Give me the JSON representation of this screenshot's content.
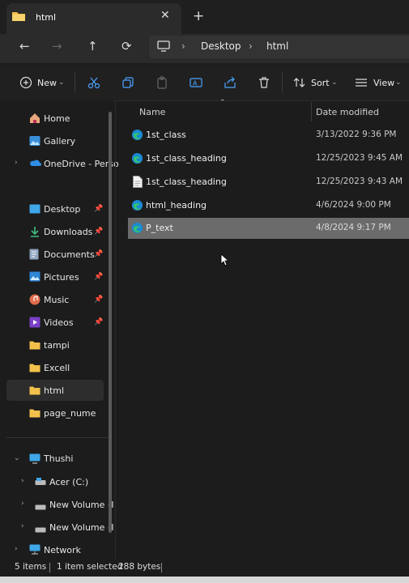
{
  "tab": {
    "title": "html",
    "close": "✕",
    "new": "+"
  },
  "nav": {
    "back": "←",
    "forward": "→",
    "up": "↑",
    "refresh": "⟳"
  },
  "breadcrumb": [
    "Desktop",
    "html"
  ],
  "toolbar": {
    "new_label": "New",
    "sort_label": "Sort",
    "view_label": "View"
  },
  "sidebar": {
    "items": [
      {
        "label": "Home"
      },
      {
        "label": "Gallery"
      },
      {
        "label": "OneDrive - Perso"
      },
      {
        "label": "Desktop"
      },
      {
        "label": "Downloads"
      },
      {
        "label": "Documents"
      },
      {
        "label": "Pictures"
      },
      {
        "label": "Music"
      },
      {
        "label": "Videos"
      },
      {
        "label": "tampi"
      },
      {
        "label": "Excell"
      },
      {
        "label": "html"
      },
      {
        "label": "page_nume"
      },
      {
        "label": "Thushi"
      },
      {
        "label": "Acer (C:)"
      },
      {
        "label": "New Volume (I"
      },
      {
        "label": "New Volume (I"
      },
      {
        "label": "Network"
      }
    ]
  },
  "columns": {
    "name": "Name",
    "date": "Date modified"
  },
  "files": [
    {
      "name": "1st_class",
      "date": "3/13/2022 9:36 PM",
      "icon": "edge-icon"
    },
    {
      "name": "1st_class_heading",
      "date": "12/25/2023 9:45 AM",
      "icon": "edge-icon"
    },
    {
      "name": "1st_class_heading",
      "date": "12/25/2023 9:43 AM",
      "icon": "text-file-icon"
    },
    {
      "name": "html_heading",
      "date": "4/6/2024 9:00 PM",
      "icon": "edge-icon"
    },
    {
      "name": "P_text",
      "date": "4/8/2024 9:17 PM",
      "icon": "edge-icon"
    }
  ],
  "status": {
    "count": "5 items",
    "selected": "1 item selected",
    "size": "288 bytes"
  },
  "colors": {
    "accent": "#0078d4",
    "folder": "#f3c04b",
    "selection": "#6b6b6b"
  }
}
